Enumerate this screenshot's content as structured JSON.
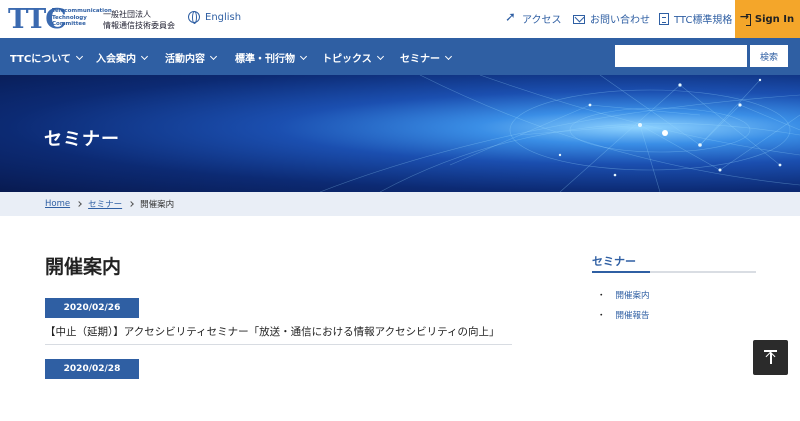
{
  "header": {
    "logo_text": "TTC",
    "logo_small": "Telecommunication Technology Committee",
    "org_name_line1": "一般社団法人",
    "org_name_line2": "情報通信技術委員会",
    "lang_label": "English",
    "links": [
      {
        "label": "アクセス",
        "icon": "send-icon"
      },
      {
        "label": "お問い合わせ",
        "icon": "mail-icon"
      },
      {
        "label": "TTC標準規格",
        "icon": "document-icon"
      }
    ],
    "signin_label": "Sign In",
    "accent_color": "#f4a62a"
  },
  "nav": {
    "items": [
      {
        "label": "TTCについて"
      },
      {
        "label": "入会案内"
      },
      {
        "label": "活動内容"
      },
      {
        "label": "標準・刊行物"
      },
      {
        "label": "トピックス"
      },
      {
        "label": "セミナー"
      }
    ],
    "search_placeholder": "",
    "search_button": "検索",
    "color": "#2f5fa3"
  },
  "hero": {
    "title": "セミナー"
  },
  "breadcrumb": {
    "home": "Home",
    "parent": "セミナー",
    "current": "開催案内"
  },
  "main": {
    "title": "開催案内",
    "events": [
      {
        "date": "2020/02/26",
        "title": "【中止（延期）】アクセシビリティセミナー「放送・通信における情報アクセシビリティの向上」"
      },
      {
        "date": "2020/02/28",
        "title": ""
      }
    ]
  },
  "sidebar": {
    "title": "セミナー",
    "items": [
      {
        "label": "開催案内"
      },
      {
        "label": "開催報告"
      }
    ]
  }
}
